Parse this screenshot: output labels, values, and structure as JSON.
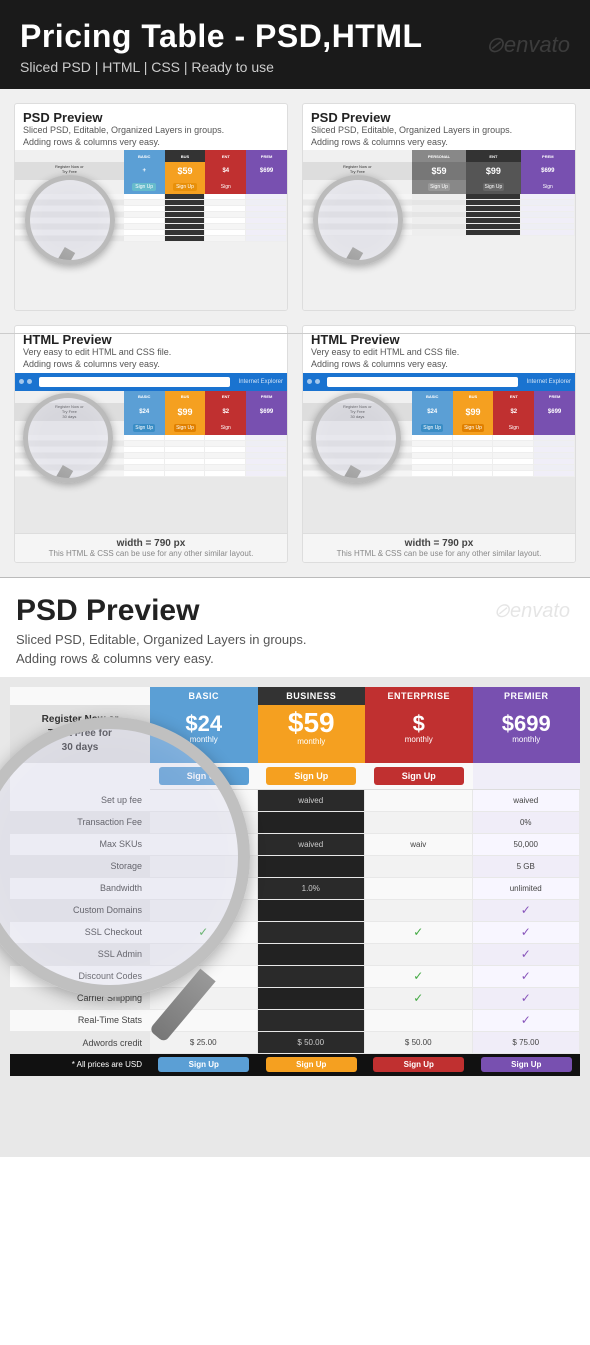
{
  "header": {
    "title": "Pricing Table - PSD,HTML",
    "subtitle": "Sliced PSD  |  HTML  |  CSS  |  Ready to use",
    "watermark": "⊘envato"
  },
  "topPanels": [
    {
      "id": "psd-preview-1",
      "label": "PSD Preview",
      "description": "Sliced PSD, Editable, Organized Layers in groups.\nAdding rows & columns very easy."
    },
    {
      "id": "psd-preview-2",
      "label": "PSD Preview",
      "description": "Sliced PSD, Editable, Organized Layers in groups.\nAdding rows & columns very easy."
    },
    {
      "id": "html-preview-1",
      "label": "HTML Preview",
      "description": "Very easy to edit HTML and CSS file.\nAdding rows & columns very easy."
    },
    {
      "id": "html-preview-2",
      "label": "HTML Preview",
      "description": "Very easy to edit HTML and CSS file.\nAdding rows & columns very easy."
    }
  ],
  "widthNote": "width = 790 px",
  "htmlNote": "This HTML & CSS can be use for any other similar layout.",
  "bottomSection": {
    "heading": "PSD Preview",
    "description": "Sliced PSD, Editable, Organized Layers in groups.\nAdding rows & columns very easy.",
    "watermark": "⊘envato"
  },
  "pricingTable": {
    "registerText": "Register Now or\nTry it Free for\n30 days",
    "columns": [
      {
        "id": "basic",
        "label": "BASIC",
        "price": "$24",
        "priceLarge": false,
        "period": "monthly"
      },
      {
        "id": "business",
        "label": "BUSINESS",
        "price": "$59",
        "priceLarge": true,
        "period": "monthly"
      },
      {
        "id": "enterprise",
        "label": "ENTERPRISE",
        "price": "$",
        "priceLarge": false,
        "period": "monthly"
      },
      {
        "id": "premier",
        "label": "PREMIER",
        "price": "$699",
        "priceLarge": false,
        "period": "monthly"
      }
    ],
    "signupLabel": "Sign Up",
    "rows": [
      {
        "label": "Set up fee",
        "values": [
          "",
          "waived",
          "",
          "waived"
        ]
      },
      {
        "label": "Transaction Fee",
        "values": [
          "",
          "",
          "",
          "0%"
        ]
      },
      {
        "label": "Max SKUs",
        "values": [
          "",
          "waived",
          "",
          "50,000"
        ]
      },
      {
        "label": "Storage",
        "values": [
          "",
          "",
          "",
          "5 GB"
        ]
      },
      {
        "label": "Bandwidth",
        "values": [
          "",
          "1.0%",
          "",
          "unlimited"
        ]
      },
      {
        "label": "Custom Domains",
        "values": [
          "",
          "",
          "",
          "✓"
        ]
      },
      {
        "label": "SSL Checkout",
        "values": [
          "✓",
          "",
          "✓",
          "✓"
        ]
      },
      {
        "label": "SSL Admin",
        "values": [
          "",
          "",
          "",
          "✓"
        ]
      },
      {
        "label": "Discount Codes",
        "values": [
          "",
          "",
          "✓",
          "✓"
        ]
      },
      {
        "label": "Carrier Shipping",
        "values": [
          "",
          "",
          "✓",
          "✓"
        ]
      },
      {
        "label": "Real-Time Stats",
        "values": [
          "",
          "",
          "",
          "✓"
        ]
      },
      {
        "label": "Adwords credit",
        "values": [
          "$25.00",
          "$50.00",
          "$50.00",
          "$75.00"
        ]
      }
    ],
    "footerNote": "* All prices are USD",
    "footerSignup": "Sign Up"
  }
}
